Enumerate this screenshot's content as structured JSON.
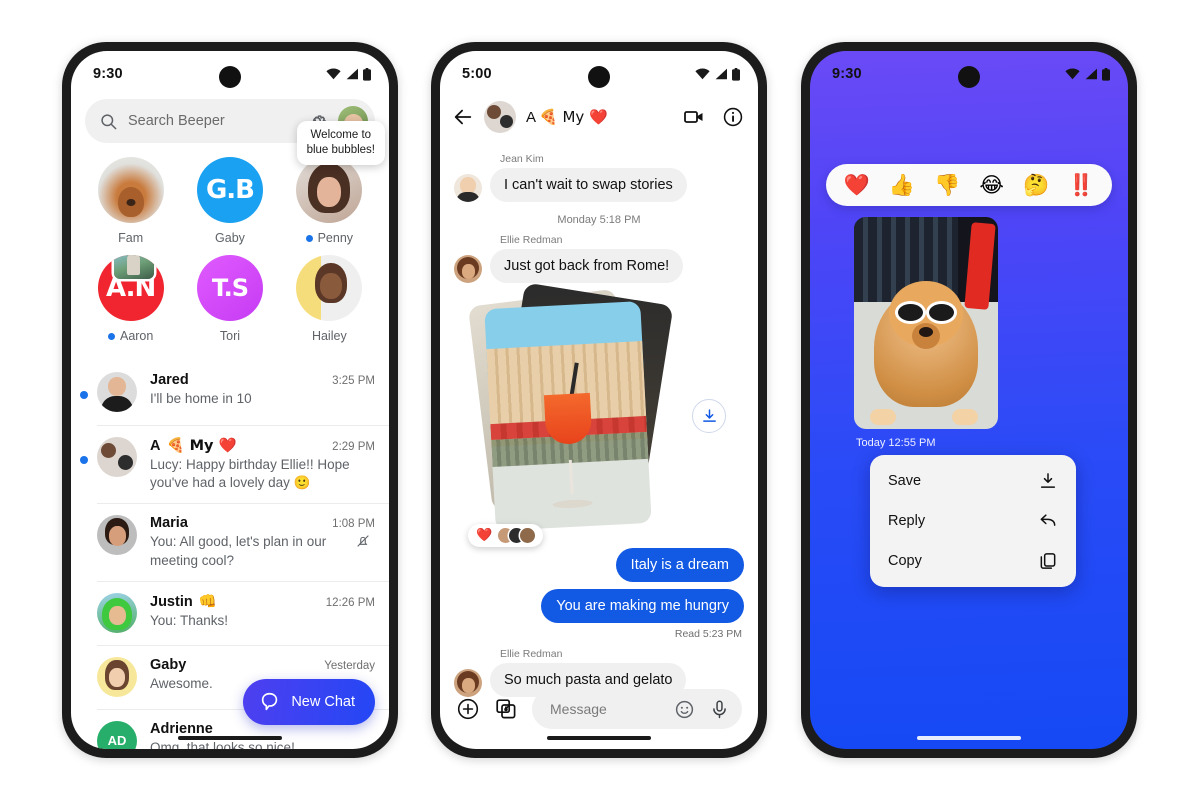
{
  "phone1": {
    "status": {
      "time": "9:30",
      "icons": [
        "wifi-icon",
        "signal-icon",
        "battery-icon"
      ]
    },
    "search": {
      "placeholder": "Search Beeper",
      "icon": "search-icon",
      "settings_icon": "gear-icon",
      "avatar": "user-avatar"
    },
    "tooltip": {
      "line1": "Welcome to",
      "line2": "blue bubbles!"
    },
    "pinned": [
      {
        "name": "Fam",
        "unread": false,
        "avatar": "dog-avatar"
      },
      {
        "name": "Gaby",
        "unread": false,
        "avatar": "gaby-logo-avatar",
        "initials": "G.B"
      },
      {
        "name": "Penny",
        "unread": true,
        "avatar": "penny-avatar"
      },
      {
        "name": "Aaron",
        "unread": true,
        "avatar": "aaron-logo-avatar",
        "initials": "A.N"
      },
      {
        "name": "Tori",
        "unread": false,
        "avatar": "tori-logo-avatar",
        "initials": "T.S"
      },
      {
        "name": "Hailey",
        "unread": false,
        "avatar": "hailey-avatar"
      }
    ],
    "chats": [
      {
        "name": "Jared",
        "name_emoji": "",
        "time": "3:25 PM",
        "preview": "I'll be home in 10",
        "unread": true,
        "muted": false,
        "avatar": "jared-avatar"
      },
      {
        "name": "A",
        "name_emoji": "🍕 My ❤️",
        "time": "2:29 PM",
        "preview": "Lucy: Happy birthday Ellie!! Hope you've had a lovely day  🙂",
        "unread": true,
        "muted": false,
        "avatar": "group-avatar"
      },
      {
        "name": "Maria",
        "name_emoji": "",
        "time": "1:08 PM",
        "preview": "You: All good, let's plan in our meeting cool?",
        "unread": false,
        "muted": true,
        "avatar": "maria-avatar"
      },
      {
        "name": "Justin",
        "name_emoji": "👊",
        "time": "12:26 PM",
        "preview": "You: Thanks!",
        "unread": false,
        "muted": false,
        "avatar": "justin-avatar"
      },
      {
        "name": "Gaby",
        "name_emoji": "",
        "time": "Yesterday",
        "preview": "Awesome.",
        "unread": false,
        "muted": false,
        "avatar": "gaby-avatar"
      },
      {
        "name": "Adrienne",
        "name_emoji": "",
        "time": "",
        "preview": "Omg, that looks so nice!",
        "unread": false,
        "muted": false,
        "avatar": "initials-avatar",
        "initials": "AD"
      }
    ],
    "fab": {
      "label": "New Chat",
      "icon": "chat-bubble-icon",
      "color": "#2b43f2"
    }
  },
  "phone2": {
    "status": {
      "time": "5:00"
    },
    "header": {
      "back_icon": "back-arrow-icon",
      "avatar": "group-avatar",
      "title": "A",
      "title_emoji": "🍕 My ❤️",
      "video_icon": "video-camera-icon",
      "info_icon": "info-circle-icon"
    },
    "messages": [
      {
        "type": "incoming",
        "sender": "Jean Kim",
        "text": "I can't wait to swap stories",
        "avatar": "jean-avatar"
      },
      {
        "type": "daystamp",
        "day": "Monday",
        "time": "5:18 PM"
      },
      {
        "type": "incoming",
        "sender": "Ellie Redman",
        "text": "Just got back from Rome!",
        "avatar": "ellie-avatar"
      },
      {
        "type": "photo-stack",
        "reaction": "❤️",
        "download_icon": "download-icon"
      },
      {
        "type": "outgoing",
        "text": "Italy is a dream"
      },
      {
        "type": "outgoing",
        "text": "You are making me hungry"
      },
      {
        "type": "readstamp",
        "status": "Read",
        "time": "5:23 PM"
      },
      {
        "type": "incoming",
        "sender": "Ellie Redman",
        "text": "So much pasta and gelato",
        "avatar": "ellie-avatar"
      }
    ],
    "composer": {
      "plus_icon": "plus-circle-icon",
      "gallery_icon": "gallery-icon",
      "placeholder": "Message",
      "emoji_icon": "emoji-smiley-icon",
      "mic_icon": "microphone-icon"
    }
  },
  "phone3": {
    "status": {
      "time": "9:30"
    },
    "background": {
      "from": "#6B4AF6",
      "to": "#1549F4"
    },
    "reactions": [
      "❤️",
      "👍",
      "👎",
      "😂",
      "🤔",
      "‼️"
    ],
    "image": {
      "alt": "dog-with-sunglasses-photo"
    },
    "image_timestamp": {
      "day": "Today",
      "time": "12:55 PM"
    },
    "context_menu": [
      {
        "label": "Save",
        "icon": "download-icon"
      },
      {
        "label": "Reply",
        "icon": "reply-arrow-icon"
      },
      {
        "label": "Copy",
        "icon": "copy-icon"
      }
    ]
  }
}
